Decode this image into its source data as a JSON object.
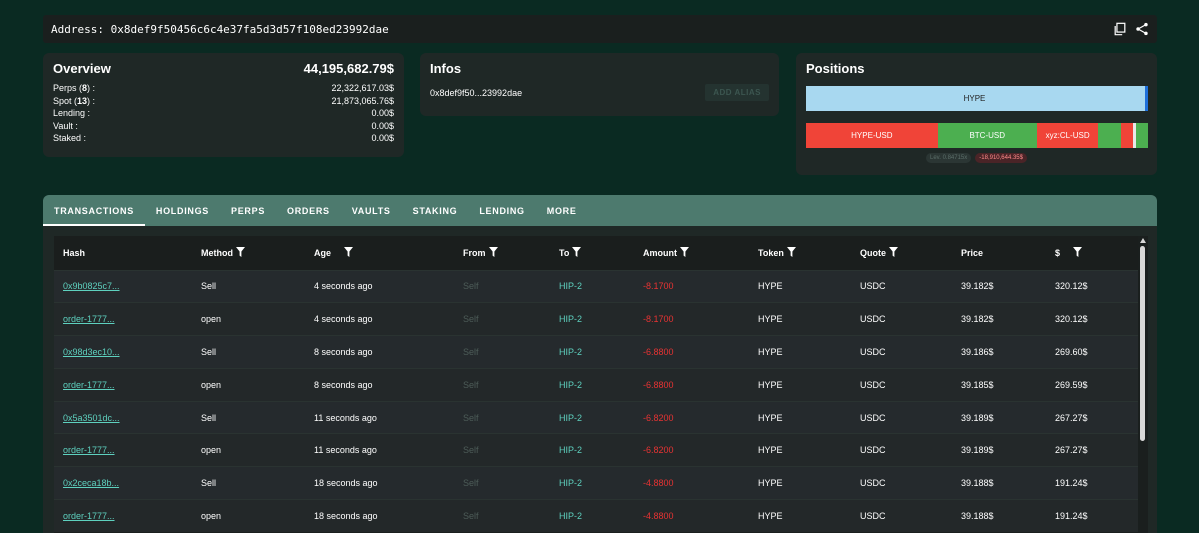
{
  "address_bar": {
    "label": "Address: 0x8def9f50456c6c4e37fa5d3d57f108ed23992dae",
    "copy_icon": "copy-icon",
    "share_icon": "share-icon"
  },
  "overview": {
    "title": "Overview",
    "total": "44,195,682.79$",
    "rows": [
      {
        "label_pre": "Perps (",
        "count": "8",
        "label_post": ") :",
        "value": "22,322,617.03$"
      },
      {
        "label_pre": "Spot (",
        "count": "13",
        "label_post": ") :",
        "value": "21,873,065.76$"
      },
      {
        "label_pre": "Lending :",
        "count": "",
        "label_post": "",
        "value": "0.00$"
      },
      {
        "label_pre": "Vault :",
        "count": "",
        "label_post": "",
        "value": "0.00$"
      },
      {
        "label_pre": "Staked :",
        "count": "",
        "label_post": "",
        "value": "0.00$"
      }
    ]
  },
  "infos": {
    "title": "Infos",
    "short_address": "0x8def9f50...23992dae",
    "add_alias": "ADD ALIAS"
  },
  "positions": {
    "title": "Positions",
    "spot_bar": {
      "label": "HYPE",
      "color": "#a8d8f0"
    },
    "perp_bar": [
      {
        "label": "HYPE-USD",
        "share": 0.385,
        "color": "#f04438"
      },
      {
        "label": "BTC-USD",
        "share": 0.29,
        "color": "#4caf50"
      },
      {
        "label": "xyz:CL-USD",
        "share": 0.18,
        "color": "#f04438"
      },
      {
        "label": "",
        "share": 0.065,
        "color": "#4caf50"
      },
      {
        "label": "",
        "share": 0.035,
        "color": "#f04438"
      },
      {
        "label": "",
        "share": 0.01,
        "color": "#e8e8e8"
      },
      {
        "label": "",
        "share": 0.035,
        "color": "#4caf50"
      }
    ],
    "leverage": "Lev. 0.84715x",
    "pnl": "-18,910,644.35$"
  },
  "tabs": [
    "TRANSACTIONS",
    "HOLDINGS",
    "PERPS",
    "ORDERS",
    "VAULTS",
    "STAKING",
    "LENDING",
    "MORE"
  ],
  "table": {
    "columns": [
      "Hash",
      "Method",
      "Age",
      "From",
      "To",
      "Amount",
      "Token",
      "Quote",
      "Price",
      "$"
    ],
    "filterable": [
      false,
      true,
      true,
      true,
      true,
      true,
      true,
      true,
      false,
      true
    ],
    "rows": [
      [
        "0x9b0825c7...",
        "Sell",
        "4 seconds ago",
        "Self",
        "HIP-2",
        "-8.1700",
        "HYPE",
        "USDC",
        "39.182$",
        "320.12$"
      ],
      [
        "order-1777...",
        "open",
        "4 seconds ago",
        "Self",
        "HIP-2",
        "-8.1700",
        "HYPE",
        "USDC",
        "39.182$",
        "320.12$"
      ],
      [
        "0x98d3ec10...",
        "Sell",
        "8 seconds ago",
        "Self",
        "HIP-2",
        "-6.8800",
        "HYPE",
        "USDC",
        "39.186$",
        "269.60$"
      ],
      [
        "order-1777...",
        "open",
        "8 seconds ago",
        "Self",
        "HIP-2",
        "-6.8800",
        "HYPE",
        "USDC",
        "39.185$",
        "269.59$"
      ],
      [
        "0x5a3501dc...",
        "Sell",
        "11 seconds ago",
        "Self",
        "HIP-2",
        "-6.8200",
        "HYPE",
        "USDC",
        "39.189$",
        "267.27$"
      ],
      [
        "order-1777...",
        "open",
        "11 seconds ago",
        "Self",
        "HIP-2",
        "-6.8200",
        "HYPE",
        "USDC",
        "39.189$",
        "267.27$"
      ],
      [
        "0x2ceca18b...",
        "Sell",
        "18 seconds ago",
        "Self",
        "HIP-2",
        "-4.8800",
        "HYPE",
        "USDC",
        "39.188$",
        "191.24$"
      ],
      [
        "order-1777...",
        "open",
        "18 seconds ago",
        "Self",
        "HIP-2",
        "-4.8800",
        "HYPE",
        "USDC",
        "39.188$",
        "191.24$"
      ]
    ]
  }
}
